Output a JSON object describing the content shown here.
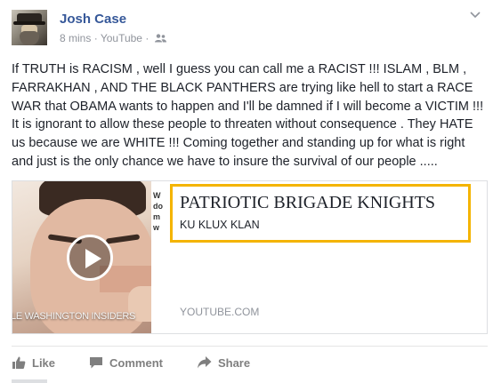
{
  "post": {
    "author": "Josh Case",
    "time": "8 mins",
    "separator1": "·",
    "source": "YouTube",
    "separator2": "·",
    "body": "If TRUTH is RACISM , well I guess you can call me a RACIST !!! ISLAM , BLM , FARRAKHAN , AND THE BLACK PANTHERS are trying like hell to start a RACE WAR that OBAMA wants to happen and I'll be damned if I will become a VICTIM !!! It is ignorant to allow these people to threaten without consequence . They HATE us because we are WHITE !!! Coming together and standing up for what is right and just is the only chance we have to insure the survival of our people .....",
    "icons": {
      "audience": "friends-icon",
      "options": "chevron-down-icon"
    }
  },
  "link_card": {
    "title": "PATRIOTIC BRIGADE KNIGHTS",
    "description": "KU KLUX KLAN",
    "domain": "YOUTUBE.COM",
    "thumbnail_caption": "LE WASHINGTON INSIDERS",
    "thumbnail_side_text": "W\ndo\nm\nw",
    "highlight_color": "#f4b400",
    "play_icon": "play-icon"
  },
  "actions": {
    "like": "Like",
    "comment": "Comment",
    "share": "Share"
  },
  "colors": {
    "author_link": "#365899",
    "meta_gray": "#90949c",
    "action_gray": "#7f7f7f"
  }
}
